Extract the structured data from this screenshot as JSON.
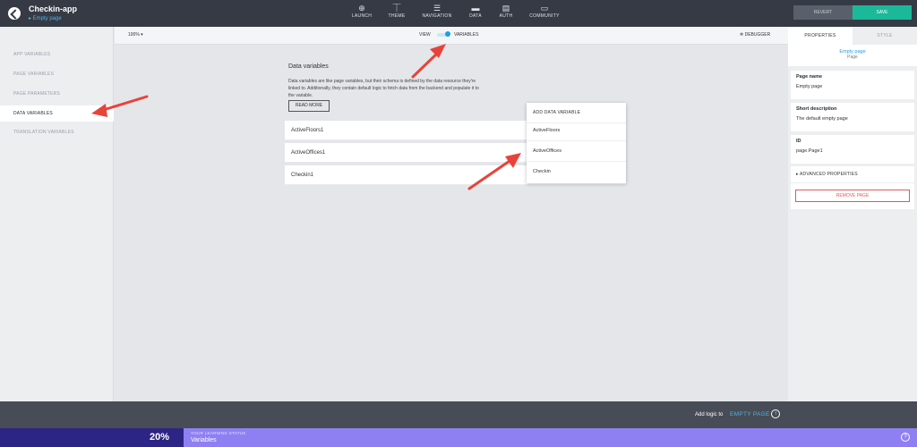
{
  "header": {
    "app_title": "Checkin-app",
    "page_link": "▸ Empty page",
    "nav": [
      {
        "label": "LAUNCH",
        "icon": "launch-icon",
        "glyph": "⊕"
      },
      {
        "label": "THEME",
        "icon": "theme-icon",
        "glyph": "⏉"
      },
      {
        "label": "NAVIGATION",
        "icon": "navigation-icon",
        "glyph": "☰"
      },
      {
        "label": "DATA",
        "icon": "data-folder-icon",
        "glyph": "▬"
      },
      {
        "label": "AUTH",
        "icon": "auth-icon",
        "glyph": "▤"
      },
      {
        "label": "COMMUNITY",
        "icon": "community-icon",
        "glyph": "▭"
      }
    ],
    "revert_label": "REVERT",
    "save_label": "SAVE"
  },
  "sidebar": {
    "items": [
      {
        "label": "APP VARIABLES"
      },
      {
        "label": "PAGE VARIABLES"
      },
      {
        "label": "PAGE PARAMETERS"
      },
      {
        "label": "DATA VARIABLES"
      },
      {
        "label": "TRANSLATION VARIABLES"
      }
    ],
    "active": "DATA VARIABLES"
  },
  "canvas_bar": {
    "zoom": "100% ▾",
    "view_label": "VIEW",
    "variables_label": "VARIABLES",
    "debugger_label": "DEBUGGER"
  },
  "main": {
    "title": "Data variables",
    "description": "Data variables are like page variables, but their schema is defined by the data resource they're linked to. Additionally, they contain default logic to fetch data from the backend and populate it to the variable.",
    "read_more_label": "READ MORE",
    "variables": [
      "ActiveFloors1",
      "ActiveOffices1",
      "Checkin1"
    ]
  },
  "dropdown": {
    "header": "ADD DATA VARIABLE",
    "items": [
      "ActiveFloors",
      "ActiveOffices",
      "Checkin"
    ]
  },
  "right_panel": {
    "tab_properties": "PROPERTIES",
    "tab_style": "STYLE",
    "context_link": "Empty page",
    "context_type": "Page",
    "page_name_label": "Page name",
    "page_name_value": "Empty page",
    "short_desc_label": "Short description",
    "short_desc_value": "The default empty page",
    "id_label": "ID",
    "id_value": "page.Page1",
    "advanced_label": "▸ ADVANCED PROPERTIES",
    "remove_label": "REMOVE PAGE"
  },
  "bottom_bar": {
    "add_logic_text": "Add logic to",
    "logic_target": "EMPTY PAGE"
  },
  "learning": {
    "percent": "20%",
    "caption": "YOUR LEARNING STATUS",
    "topic": "Variables"
  },
  "colors": {
    "topbar": "#353a44",
    "accent": "#1e9fe0",
    "save": "#1bb99a",
    "danger": "#e05a5a",
    "annotation_arrow": "#e8433a",
    "learning_dark": "#2d2585",
    "learning_light": "#8e80f2"
  }
}
